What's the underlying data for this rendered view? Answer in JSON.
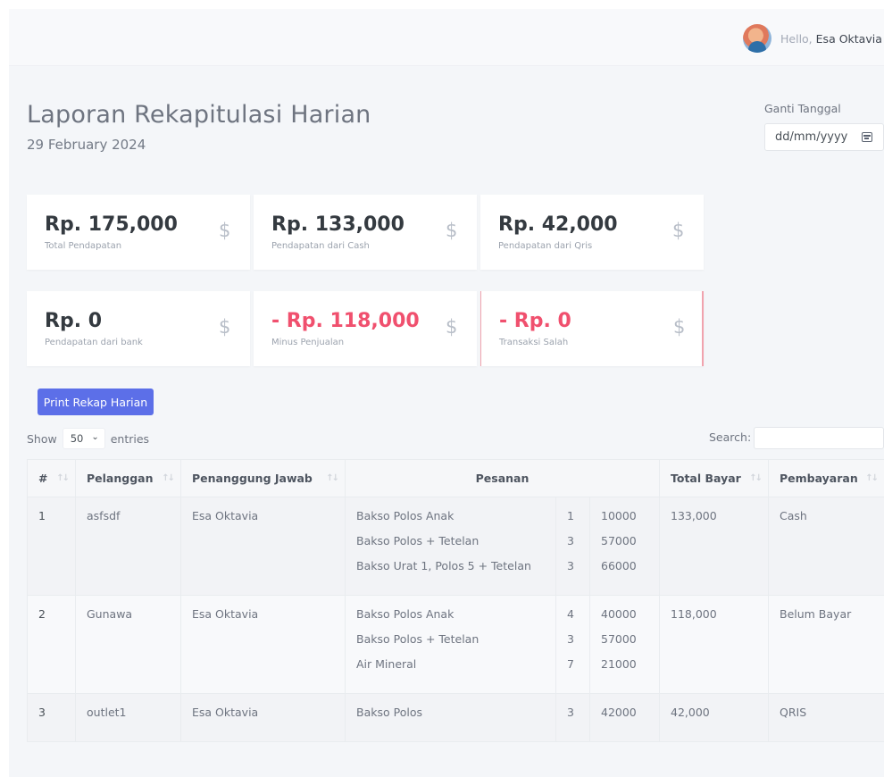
{
  "topbar": {
    "greeting": "Hello,",
    "user_name": "Esa Oktavia"
  },
  "header": {
    "title": "Laporan Rekapitulasi Harian",
    "date": "29 February 2024",
    "date_picker_label": "Ganti Tanggal",
    "date_picker_placeholder": "dd/mm/yyyy"
  },
  "stats": [
    {
      "value": "Rp. 175,000",
      "label": "Total Pendapatan",
      "negative": false
    },
    {
      "value": "Rp. 133,000",
      "label": "Pendapatan dari Cash",
      "negative": false
    },
    {
      "value": "Rp. 42,000",
      "label": "Pendapatan dari Qris",
      "negative": false
    },
    {
      "value": "Rp. 0",
      "label": "Pendapatan dari bank",
      "negative": false
    },
    {
      "value": "- Rp. 118,000",
      "label": "Minus Penjualan",
      "negative": true
    },
    {
      "value": "- Rp. 0",
      "label": "Transaksi Salah",
      "negative": true
    }
  ],
  "stat_icon": "dollar-icon",
  "print_button": "Print Rekap Harian",
  "table_controls": {
    "show_label": "Show",
    "entries_value": "50",
    "entries_label": "entries",
    "search_label": "Search:"
  },
  "table": {
    "headers": [
      "#",
      "Pelanggan",
      "Penanggung Jawab",
      "Pesanan",
      "Total Bayar",
      "Pembayaran"
    ],
    "rows": [
      {
        "no": "1",
        "pelanggan": "asfsdf",
        "penanggung_jawab": "Esa Oktavia",
        "items": [
          {
            "name": "Bakso Polos Anak",
            "qty": "1",
            "price": "10000"
          },
          {
            "name": "Bakso Polos + Tetelan",
            "qty": "3",
            "price": "57000"
          },
          {
            "name": "Bakso Urat 1, Polos 5 + Tetelan",
            "qty": "3",
            "price": "66000"
          }
        ],
        "total": "133,000",
        "pembayaran": "Cash"
      },
      {
        "no": "2",
        "pelanggan": "Gunawa",
        "penanggung_jawab": "Esa Oktavia",
        "items": [
          {
            "name": "Bakso Polos Anak",
            "qty": "4",
            "price": "40000"
          },
          {
            "name": "Bakso Polos + Tetelan",
            "qty": "3",
            "price": "57000"
          },
          {
            "name": "Air Mineral",
            "qty": "7",
            "price": "21000"
          }
        ],
        "total": "118,000",
        "pembayaran": "Belum Bayar"
      },
      {
        "no": "3",
        "pelanggan": "outlet1",
        "penanggung_jawab": "Esa Oktavia",
        "items": [
          {
            "name": "Bakso Polos",
            "qty": "3",
            "price": "42000"
          }
        ],
        "total": "42,000",
        "pembayaran": "QRIS"
      }
    ]
  },
  "colors": {
    "primary_button": "#5c6fe8",
    "negative_value": "#f0506e",
    "background": "#f4f6f9"
  }
}
